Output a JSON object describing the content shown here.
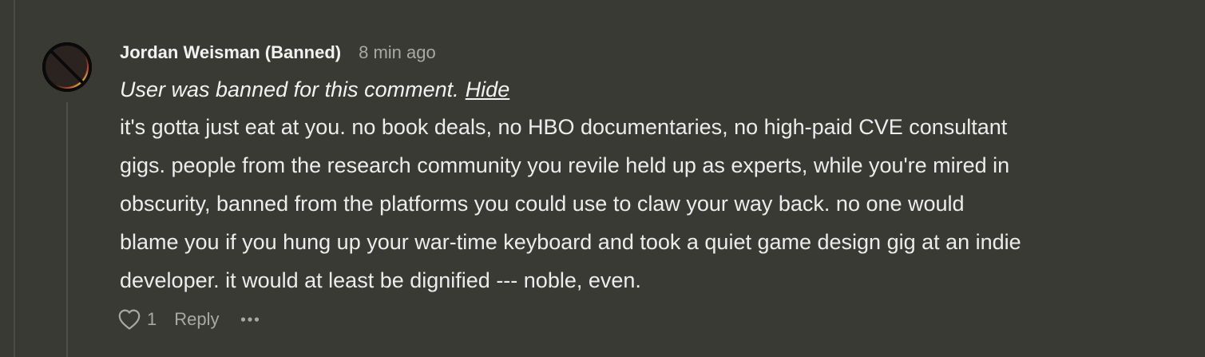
{
  "comment": {
    "author": "Jordan Weisman (Banned)",
    "timestamp": "8 min ago",
    "ban_notice": "User was banned for this comment.",
    "hide_label": "Hide",
    "body_lines": [
      "it's gotta just eat at you. no book deals, no HBO documentaries, no high-paid CVE consultant",
      "gigs. people from the research community you revile held up as experts, while you're mired in",
      "obscurity, banned from the platforms you could use to claw your way back. no one would",
      "blame you if you hung up your war-time keyboard and took a quiet game design gig at an indie",
      "developer. it would at least be dignified --- noble, even."
    ],
    "like_count": "1",
    "reply_label": "Reply",
    "more_icon": "ellipsis-icon",
    "like_icon": "heart-icon",
    "avatar_icon": "banned-avatar-icon"
  },
  "colors": {
    "background": "#3a3a35",
    "text_primary": "#ececec",
    "text_muted": "#a9a9a3",
    "thread_line": "#4f4f4a"
  }
}
